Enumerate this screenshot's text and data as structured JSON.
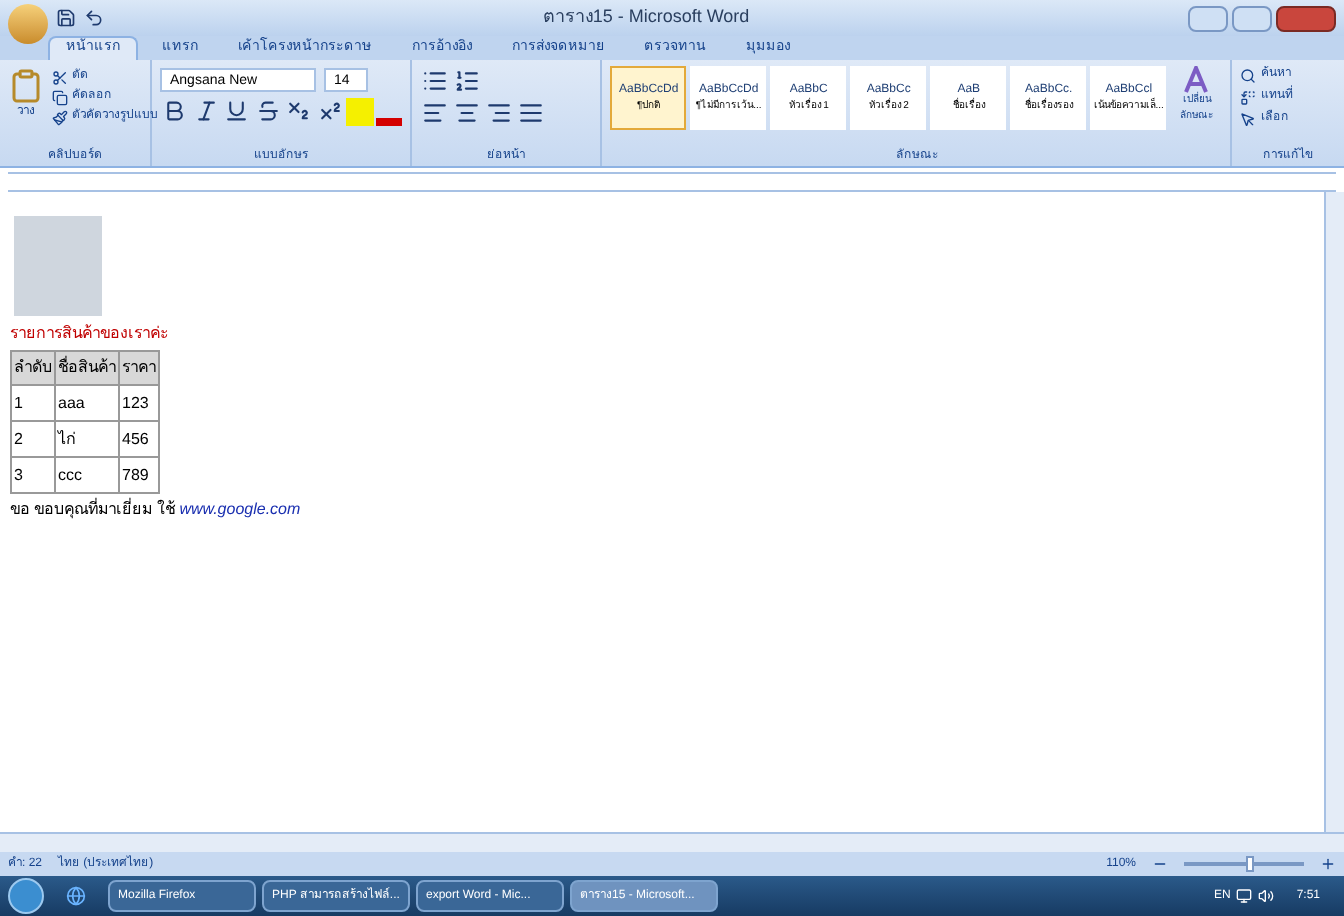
{
  "window": {
    "title": "ตาราง15 - Microsoft Word"
  },
  "tabs": [
    {
      "label": "หน้าแรก",
      "selected": true
    },
    {
      "label": "แทรก",
      "selected": false
    },
    {
      "label": "เค้าโครงหน้ากระดาษ",
      "selected": false
    },
    {
      "label": "การอ้างอิง",
      "selected": false
    },
    {
      "label": "การส่งจดหมาย",
      "selected": false
    },
    {
      "label": "ตรวจทาน",
      "selected": false
    },
    {
      "label": "มุมมอง",
      "selected": false
    }
  ],
  "ribbon": {
    "clipboard": {
      "paste": "วาง",
      "cut": "ตัด",
      "copy": "คัดลอก",
      "format_painter": "ตัวคัดวางรูปแบบ",
      "group": "คลิปบอร์ด"
    },
    "font": {
      "name": "Angsana New",
      "size": "14",
      "group": "แบบอักษร"
    },
    "paragraph": {
      "group": "ย่อหน้า"
    },
    "styles": {
      "items": [
        {
          "sample": "AaBbCcDd",
          "label": "¶ปกติ",
          "selected": true
        },
        {
          "sample": "AaBbCcDd",
          "label": "¶ไม่มีการเว้น...",
          "selected": false
        },
        {
          "sample": "AaBbC",
          "label": "หัวเรื่อง 1",
          "selected": false
        },
        {
          "sample": "AaBbCc",
          "label": "หัวเรื่อง 2",
          "selected": false
        },
        {
          "sample": "AaB",
          "label": "ชื่อเรื่อง",
          "selected": false
        },
        {
          "sample": "AaBbCc.",
          "label": "ชื่อเรื่องรอง",
          "selected": false
        },
        {
          "sample": "AaBbCcl",
          "label": "เน้นข้อความเล็...",
          "selected": false
        }
      ],
      "change": "เปลี่ยนลักษณะ",
      "group": "ลักษณะ"
    },
    "editing": {
      "find": "ค้นหา",
      "replace": "แทนที่",
      "select": "เลือก",
      "group": "การแก้ไข"
    }
  },
  "document": {
    "heading": "รายการสินค้าของเราค่ะ",
    "table": {
      "columns": [
        "ลำดับ",
        "ชื่อสินค้า",
        "ราคา"
      ],
      "rows": [
        [
          "1",
          "aaa",
          "123"
        ],
        [
          "2",
          "ไก่",
          "456"
        ],
        [
          "3",
          "ccc",
          "789"
        ]
      ]
    },
    "footer_text": "ขอ ขอบคุณที่มาเยี่ยม ใช้",
    "link": "www.google.com"
  },
  "status_bar": {
    "words": "คำ: 22",
    "language": "ไทย (ประเทศไทย)",
    "zoom": "110%",
    "zoom_slider": {
      "level": 0.55
    }
  },
  "taskbar": {
    "items": [
      {
        "label": "Mozilla Firefox",
        "selected": false
      },
      {
        "label": "PHP สามารถสร้างไฟล์...",
        "selected": false
      },
      {
        "label": "export Word - Mic...",
        "selected": false
      },
      {
        "label": "ตาราง15 - Microsoft...",
        "selected": true
      }
    ],
    "language": "EN",
    "time": "7:51"
  }
}
